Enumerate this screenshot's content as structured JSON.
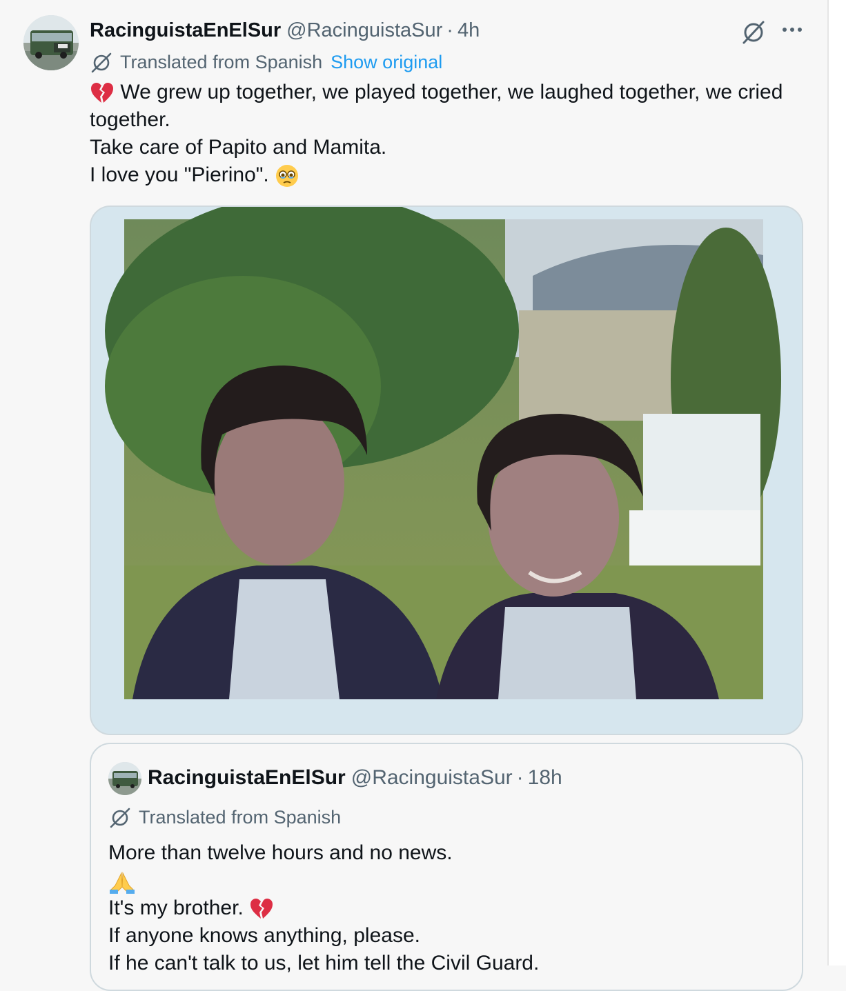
{
  "tweet": {
    "display_name": "RacinguistaEnElSur",
    "handle": "@RacinguistaSur",
    "separator": "·",
    "time": "4h",
    "translated_label": "Translated from Spanish",
    "show_original": "Show original",
    "lines": [
      "We grew up together, we played together, we laughed together, we cried",
      "together.",
      "Take care of Papito and Mamita.",
      "I love you \"Pierino\"."
    ],
    "media_icon": "photo-of-two-boys",
    "avatar_icon": "green-bus-avatar"
  },
  "quoted_tweet": {
    "display_name": "RacinguistaEnElSur",
    "handle": "@RacinguistaSur",
    "separator": "·",
    "time": "18h",
    "translated_label": "Translated from Spanish",
    "lines": [
      "More than twelve hours and no news.",
      "",
      " It's my brother.",
      "If anyone knows anything, please.",
      "If he can't talk to us, let him tell the Civil Guard."
    ]
  },
  "icons": {
    "grok": "grok-icon",
    "more": "more-options-icon",
    "translate": "translate-icon",
    "broken_heart": "broken-heart-emoji",
    "teary_face": "face-holding-back-tears-emoji",
    "pray": "folded-hands-emoji"
  },
  "colors": {
    "text": "#0f1419",
    "secondary": "#536471",
    "link": "#1d9bf0",
    "background": "#f7f7f7",
    "border": "#cfd9de"
  }
}
